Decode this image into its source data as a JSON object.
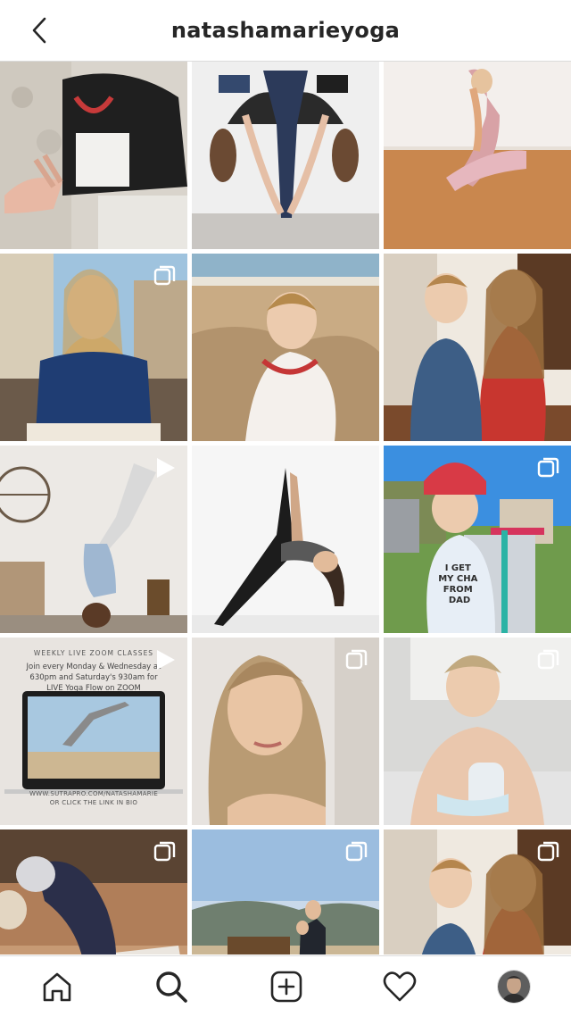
{
  "header": {
    "title": "natashamarieyoga"
  },
  "icons": {
    "back": "chevron-left-icon",
    "carousel": "carousel-icon",
    "video": "video-play-icon",
    "home": "home-icon",
    "search": "search-icon",
    "add": "add-post-icon",
    "activity": "heart-icon",
    "profile": "profile-avatar"
  },
  "posts": [
    {
      "kind": "photo"
    },
    {
      "kind": "photo"
    },
    {
      "kind": "photo"
    },
    {
      "kind": "carousel"
    },
    {
      "kind": "photo"
    },
    {
      "kind": "photo"
    },
    {
      "kind": "video"
    },
    {
      "kind": "photo"
    },
    {
      "kind": "carousel"
    },
    {
      "kind": "video"
    },
    {
      "kind": "carousel"
    },
    {
      "kind": "carousel"
    },
    {
      "kind": "carousel"
    },
    {
      "kind": "carousel"
    },
    {
      "kind": "carousel"
    }
  ],
  "zoom_post": {
    "heading": "WEEKLY LIVE ZOOM CLASSES",
    "line1": "Join every Monday & Wednesday at",
    "line2": "630pm and Saturday's 930am for",
    "line3": "LIVE Yoga Flow on ZOOM",
    "url": "WWW.SUTRAPRO.COM/NATASHAMARIE",
    "cta": "OR CLICK THE LINK IN BIO"
  },
  "toddler_shirt": {
    "line1": "I GET",
    "line2": "MY CHA",
    "line3": "FROM",
    "line4": "DAD"
  }
}
